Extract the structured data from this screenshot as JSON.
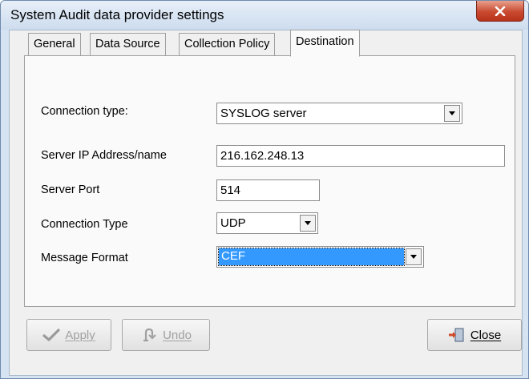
{
  "window": {
    "title": "System Audit data provider settings",
    "close_icon": "close-x-icon",
    "close_color": "#c94a30"
  },
  "tabs": [
    {
      "label": "General",
      "active": false
    },
    {
      "label": "Data Source",
      "active": false
    },
    {
      "label": "Collection Policy",
      "active": false
    },
    {
      "label": "Destination",
      "active": true
    }
  ],
  "form": {
    "connection_type_label": "Connection type:",
    "connection_type_value": "SYSLOG server",
    "server_ip_label": "Server IP Address/name",
    "server_ip_value": "216.162.248.13",
    "server_port_label": "Server Port",
    "server_port_value": "514",
    "protocol_label": "Connection Type",
    "protocol_value": "UDP",
    "message_format_label": "Message Format",
    "message_format_value": "CEF"
  },
  "buttons": {
    "apply_label": "Apply",
    "apply_enabled": false,
    "apply_icon": "checkmark-icon",
    "undo_label": "Undo",
    "undo_enabled": false,
    "undo_icon": "undo-icon",
    "close_label": "Close",
    "close_icon": "exit-door-icon"
  },
  "colors": {
    "selection": "#3399ff",
    "window_frame": "#d6e3f2"
  }
}
